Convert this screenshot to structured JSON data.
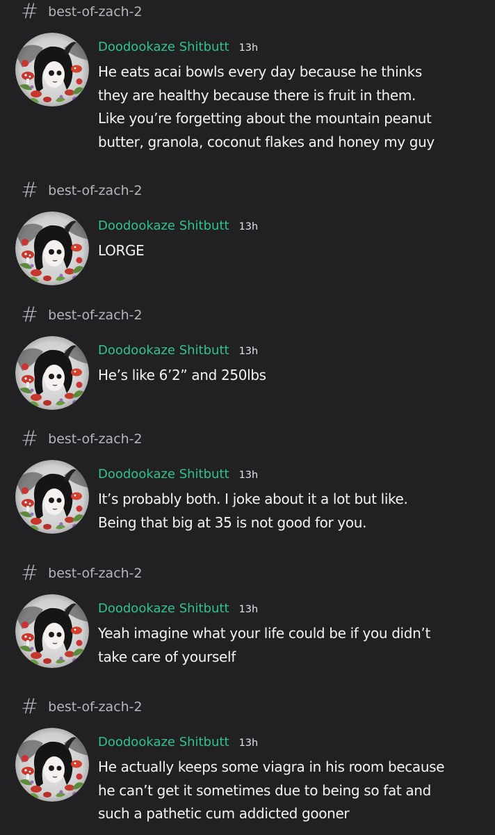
{
  "channel_name": "best-of-zach-2",
  "hash_glyph": "#",
  "colors": {
    "background": "#212124",
    "username": "#2fc38b",
    "message_text": "#f2f3f5",
    "channel_text": "#b5b6bb"
  },
  "messages": [
    {
      "channel": "best-of-zach-2",
      "author": "Doodookaze Shitbutt",
      "timestamp": "13h",
      "text": "He eats acai bowls every day because he thinks\nthey are healthy because there is fruit in them.\nLike you’re forgetting about the mountain peanut\nbutter, granola, coconut flakes and honey my guy"
    },
    {
      "channel": "best-of-zach-2",
      "author": "Doodookaze Shitbutt",
      "timestamp": "13h",
      "text": "LORGE"
    },
    {
      "channel": "best-of-zach-2",
      "author": "Doodookaze Shitbutt",
      "timestamp": "13h",
      "text": "He’s like 6’2” and 250lbs"
    },
    {
      "channel": "best-of-zach-2",
      "author": "Doodookaze Shitbutt",
      "timestamp": "13h",
      "text": "It’s probably both. I joke about it a lot but like.\nBeing that big at 35 is not good for you."
    },
    {
      "channel": "best-of-zach-2",
      "author": "Doodookaze Shitbutt",
      "timestamp": "13h",
      "text": "Yeah imagine what your life could be if you didn’t\ntake care of yourself"
    },
    {
      "channel": "best-of-zach-2",
      "author": "Doodookaze Shitbutt",
      "timestamp": "13h",
      "text": "He actually keeps some viagra in his room because\nhe can’t get it sometimes due to being so fat and\nsuch a pathetic cum addicted gooner"
    }
  ]
}
